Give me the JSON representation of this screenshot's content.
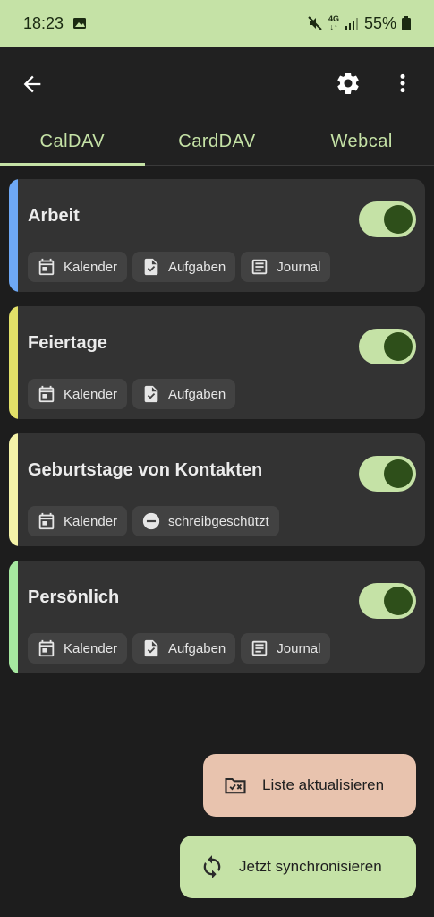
{
  "status_bar": {
    "time": "18:23",
    "network": [
      "4G",
      "↓↑"
    ],
    "battery_percent": "55%",
    "icons": [
      "image-icon",
      "mute-icon",
      "signal-icon",
      "battery-icon"
    ]
  },
  "app_bar": {
    "icons": [
      "back-arrow-icon",
      "gear-icon",
      "more-vert-icon"
    ]
  },
  "tabs": [
    {
      "label": "CalDAV",
      "active": true
    },
    {
      "label": "CardDAV",
      "active": false
    },
    {
      "label": "Webcal",
      "active": false
    }
  ],
  "calendars": [
    {
      "name": "Arbeit",
      "color": "#6ea8f5",
      "enabled": true,
      "chips": [
        {
          "icon": "calendar-icon",
          "label": "Kalender"
        },
        {
          "icon": "tasks-icon",
          "label": "Aufgaben"
        },
        {
          "icon": "journal-icon",
          "label": "Journal"
        }
      ]
    },
    {
      "name": "Feiertage",
      "color": "#e2e068",
      "enabled": true,
      "chips": [
        {
          "icon": "calendar-icon",
          "label": "Kalender"
        },
        {
          "icon": "tasks-icon",
          "label": "Aufgaben"
        }
      ]
    },
    {
      "name": "Geburtstage von Kontakten",
      "color": "#f5f3a8",
      "enabled": true,
      "chips": [
        {
          "icon": "calendar-icon",
          "label": "Kalender"
        },
        {
          "icon": "readonly-icon",
          "label": "schreibgeschützt"
        }
      ]
    },
    {
      "name": "Persönlich",
      "color": "#a6e8a0",
      "enabled": true,
      "chips": [
        {
          "icon": "calendar-icon",
          "label": "Kalender"
        },
        {
          "icon": "tasks-icon",
          "label": "Aufgaben"
        },
        {
          "icon": "journal-icon",
          "label": "Journal"
        }
      ]
    }
  ],
  "fabs": {
    "refresh_label": "Liste aktualisieren",
    "sync_label": "Jetzt synchronisieren"
  },
  "colors": {
    "accent": "#c5e2a6",
    "background": "#1d1d1d",
    "card": "#333333",
    "refresh_fab": "#e8c3ae",
    "toggle_knob": "#2e4f1a"
  }
}
